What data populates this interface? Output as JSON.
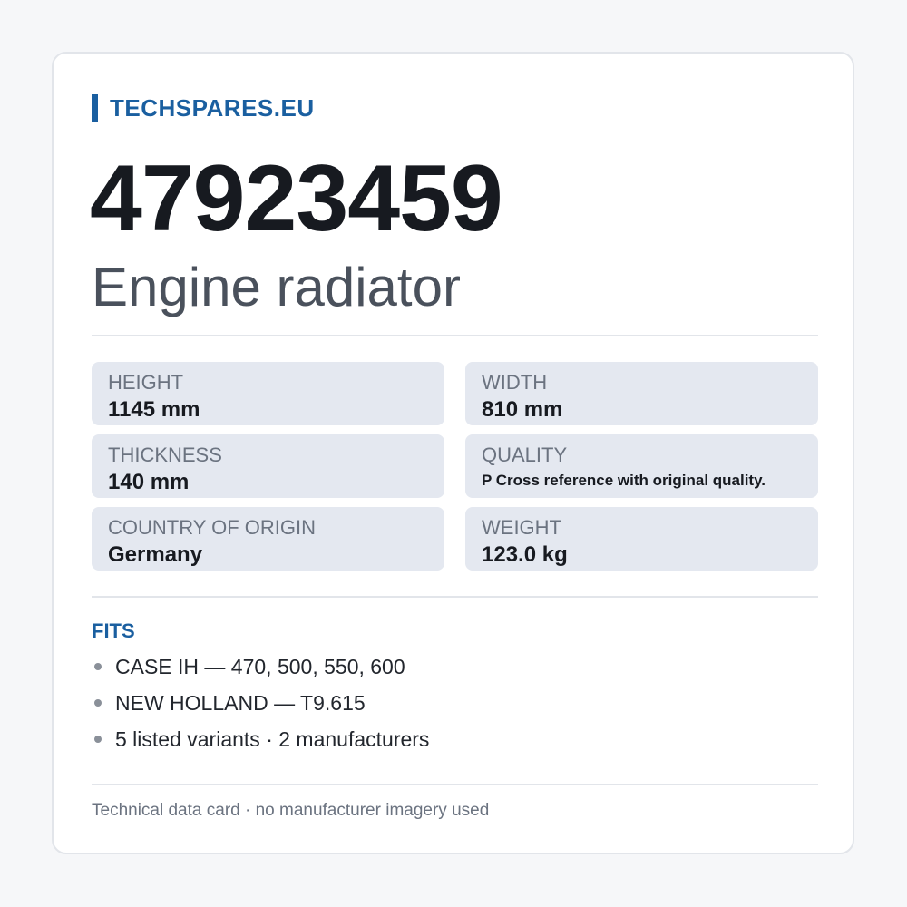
{
  "brand": {
    "name": "TECHSPARES.EU",
    "accent_color": "#1a5fa0"
  },
  "part": {
    "number": "47923459",
    "name": "Engine radiator"
  },
  "specs": [
    {
      "label": "HEIGHT",
      "value": "1145 mm"
    },
    {
      "label": "WIDTH",
      "value": "810 mm"
    },
    {
      "label": "THICKNESS",
      "value": "140 mm"
    },
    {
      "label": "QUALITY",
      "value": "P Cross reference with original quality."
    },
    {
      "label": "COUNTRY OF ORIGIN",
      "value": "Germany"
    },
    {
      "label": "WEIGHT",
      "value": "123.0 kg"
    }
  ],
  "fits": {
    "title": "FITS",
    "items": [
      "CASE IH — 470, 500, 550, 600",
      "NEW HOLLAND — T9.615",
      "5 listed variants · 2 manufacturers"
    ]
  },
  "footer": {
    "text": "Technical data card · no manufacturer imagery used"
  }
}
